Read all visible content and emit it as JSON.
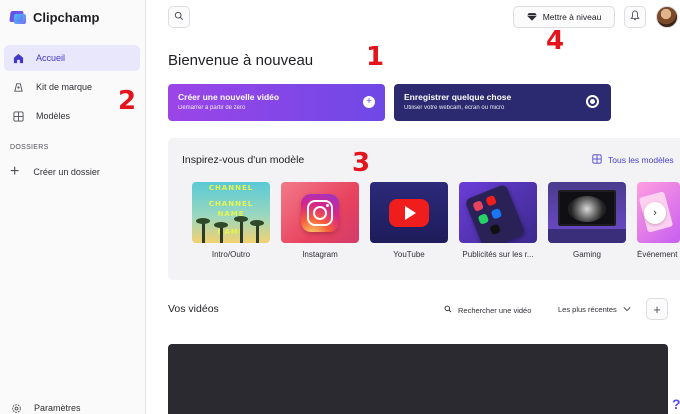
{
  "app": {
    "name": "Clipchamp"
  },
  "sidebar": {
    "items": [
      {
        "label": "Accueil",
        "icon": "home-icon",
        "active": true
      },
      {
        "label": "Kit de marque",
        "icon": "brand-kit-icon",
        "active": false
      },
      {
        "label": "Modèles",
        "icon": "templates-icon",
        "active": false
      }
    ],
    "folders_section_title": "DOSSIERS",
    "create_folder_label": "Créer un dossier",
    "settings_label": "Paramètres"
  },
  "topbar": {
    "search_icon": "search-icon",
    "upgrade_label": "Mettre à niveau",
    "upgrade_icon": "diamond-icon",
    "bell_icon": "bell-icon"
  },
  "main": {
    "welcome_title": "Bienvenue à nouveau",
    "create_card": {
      "title": "Créer une nouvelle vidéo",
      "subtitle": "Démarrer à partir de zéro"
    },
    "record_card": {
      "title": "Enregistrer quelque chose",
      "subtitle": "Utiliser votre webcam, écran ou micro"
    }
  },
  "templates": {
    "title": "Inspirez-vous d'un modèle",
    "all_label": "Tous les modèles",
    "intro_thumb_text": [
      "CHANNEL",
      "CHANNEL",
      "NAME",
      "NAME"
    ],
    "items": [
      {
        "label": "Intro/Outro"
      },
      {
        "label": "Instagram"
      },
      {
        "label": "YouTube"
      },
      {
        "label": "Publicités sur les r..."
      },
      {
        "label": "Gaming"
      },
      {
        "label": "Événement"
      }
    ]
  },
  "videos": {
    "title": "Vos vidéos",
    "search_label": "Rechercher une vidéo",
    "sort_label": "Les plus récentes",
    "add_icon": "plus-icon"
  },
  "annotations": [
    "1",
    "2",
    "3",
    "4"
  ],
  "colors": {
    "accent": "#4339c8",
    "create_gradient_start": "#9b45e8",
    "create_gradient_end": "#6f48e6",
    "record_bg": "#2b2a70",
    "annotation_red": "#e4141c"
  }
}
